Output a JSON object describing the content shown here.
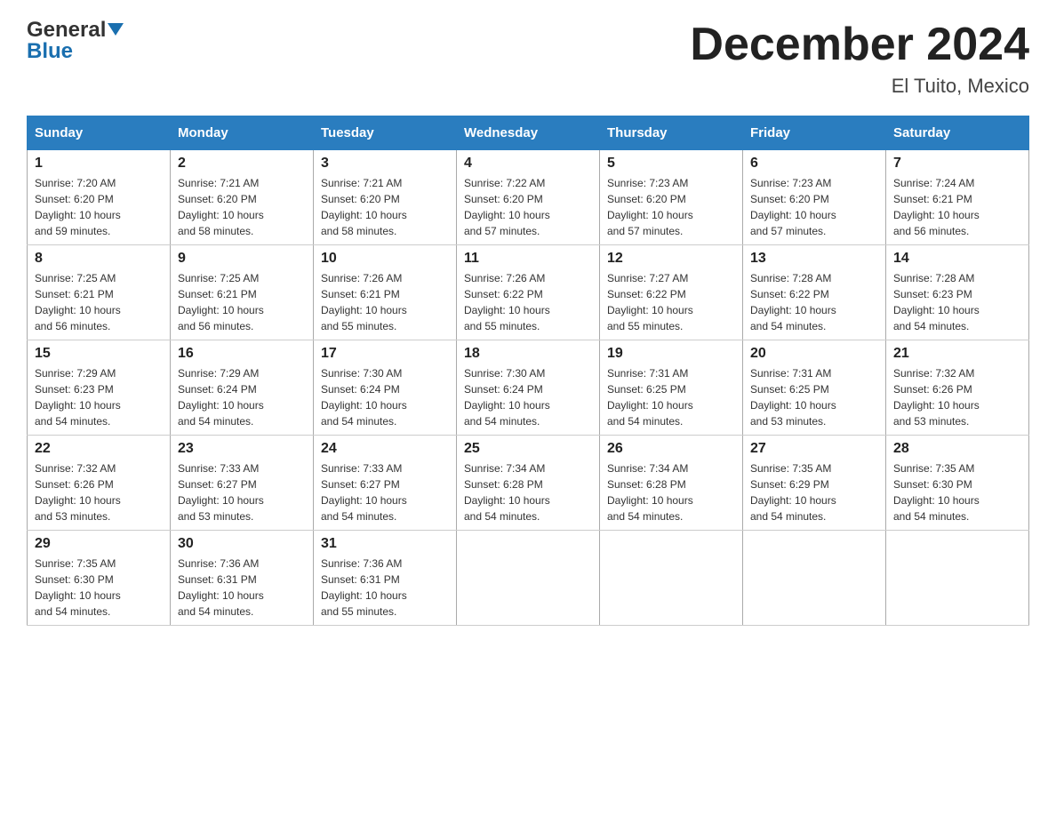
{
  "header": {
    "logo_line1": "General",
    "logo_line2": "Blue",
    "month_title": "December 2024",
    "location": "El Tuito, Mexico"
  },
  "days_of_week": [
    "Sunday",
    "Monday",
    "Tuesday",
    "Wednesday",
    "Thursday",
    "Friday",
    "Saturday"
  ],
  "weeks": [
    [
      {
        "day": 1,
        "sunrise": "7:20 AM",
        "sunset": "6:20 PM",
        "daylight": "10 hours and 59 minutes."
      },
      {
        "day": 2,
        "sunrise": "7:21 AM",
        "sunset": "6:20 PM",
        "daylight": "10 hours and 58 minutes."
      },
      {
        "day": 3,
        "sunrise": "7:21 AM",
        "sunset": "6:20 PM",
        "daylight": "10 hours and 58 minutes."
      },
      {
        "day": 4,
        "sunrise": "7:22 AM",
        "sunset": "6:20 PM",
        "daylight": "10 hours and 57 minutes."
      },
      {
        "day": 5,
        "sunrise": "7:23 AM",
        "sunset": "6:20 PM",
        "daylight": "10 hours and 57 minutes."
      },
      {
        "day": 6,
        "sunrise": "7:23 AM",
        "sunset": "6:20 PM",
        "daylight": "10 hours and 57 minutes."
      },
      {
        "day": 7,
        "sunrise": "7:24 AM",
        "sunset": "6:21 PM",
        "daylight": "10 hours and 56 minutes."
      }
    ],
    [
      {
        "day": 8,
        "sunrise": "7:25 AM",
        "sunset": "6:21 PM",
        "daylight": "10 hours and 56 minutes."
      },
      {
        "day": 9,
        "sunrise": "7:25 AM",
        "sunset": "6:21 PM",
        "daylight": "10 hours and 56 minutes."
      },
      {
        "day": 10,
        "sunrise": "7:26 AM",
        "sunset": "6:21 PM",
        "daylight": "10 hours and 55 minutes."
      },
      {
        "day": 11,
        "sunrise": "7:26 AM",
        "sunset": "6:22 PM",
        "daylight": "10 hours and 55 minutes."
      },
      {
        "day": 12,
        "sunrise": "7:27 AM",
        "sunset": "6:22 PM",
        "daylight": "10 hours and 55 minutes."
      },
      {
        "day": 13,
        "sunrise": "7:28 AM",
        "sunset": "6:22 PM",
        "daylight": "10 hours and 54 minutes."
      },
      {
        "day": 14,
        "sunrise": "7:28 AM",
        "sunset": "6:23 PM",
        "daylight": "10 hours and 54 minutes."
      }
    ],
    [
      {
        "day": 15,
        "sunrise": "7:29 AM",
        "sunset": "6:23 PM",
        "daylight": "10 hours and 54 minutes."
      },
      {
        "day": 16,
        "sunrise": "7:29 AM",
        "sunset": "6:24 PM",
        "daylight": "10 hours and 54 minutes."
      },
      {
        "day": 17,
        "sunrise": "7:30 AM",
        "sunset": "6:24 PM",
        "daylight": "10 hours and 54 minutes."
      },
      {
        "day": 18,
        "sunrise": "7:30 AM",
        "sunset": "6:24 PM",
        "daylight": "10 hours and 54 minutes."
      },
      {
        "day": 19,
        "sunrise": "7:31 AM",
        "sunset": "6:25 PM",
        "daylight": "10 hours and 54 minutes."
      },
      {
        "day": 20,
        "sunrise": "7:31 AM",
        "sunset": "6:25 PM",
        "daylight": "10 hours and 53 minutes."
      },
      {
        "day": 21,
        "sunrise": "7:32 AM",
        "sunset": "6:26 PM",
        "daylight": "10 hours and 53 minutes."
      }
    ],
    [
      {
        "day": 22,
        "sunrise": "7:32 AM",
        "sunset": "6:26 PM",
        "daylight": "10 hours and 53 minutes."
      },
      {
        "day": 23,
        "sunrise": "7:33 AM",
        "sunset": "6:27 PM",
        "daylight": "10 hours and 53 minutes."
      },
      {
        "day": 24,
        "sunrise": "7:33 AM",
        "sunset": "6:27 PM",
        "daylight": "10 hours and 54 minutes."
      },
      {
        "day": 25,
        "sunrise": "7:34 AM",
        "sunset": "6:28 PM",
        "daylight": "10 hours and 54 minutes."
      },
      {
        "day": 26,
        "sunrise": "7:34 AM",
        "sunset": "6:28 PM",
        "daylight": "10 hours and 54 minutes."
      },
      {
        "day": 27,
        "sunrise": "7:35 AM",
        "sunset": "6:29 PM",
        "daylight": "10 hours and 54 minutes."
      },
      {
        "day": 28,
        "sunrise": "7:35 AM",
        "sunset": "6:30 PM",
        "daylight": "10 hours and 54 minutes."
      }
    ],
    [
      {
        "day": 29,
        "sunrise": "7:35 AM",
        "sunset": "6:30 PM",
        "daylight": "10 hours and 54 minutes."
      },
      {
        "day": 30,
        "sunrise": "7:36 AM",
        "sunset": "6:31 PM",
        "daylight": "10 hours and 54 minutes."
      },
      {
        "day": 31,
        "sunrise": "7:36 AM",
        "sunset": "6:31 PM",
        "daylight": "10 hours and 55 minutes."
      },
      null,
      null,
      null,
      null
    ]
  ],
  "labels": {
    "sunrise": "Sunrise:",
    "sunset": "Sunset:",
    "daylight": "Daylight:"
  }
}
